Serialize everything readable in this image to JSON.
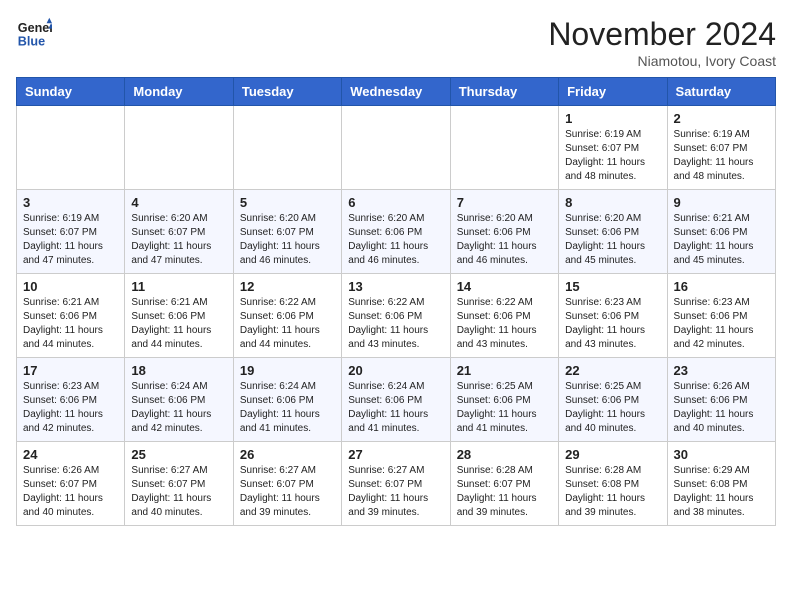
{
  "header": {
    "logo_line1": "General",
    "logo_line2": "Blue",
    "month": "November 2024",
    "location": "Niamotou, Ivory Coast"
  },
  "weekdays": [
    "Sunday",
    "Monday",
    "Tuesday",
    "Wednesday",
    "Thursday",
    "Friday",
    "Saturday"
  ],
  "weeks": [
    [
      {
        "day": "",
        "info": ""
      },
      {
        "day": "",
        "info": ""
      },
      {
        "day": "",
        "info": ""
      },
      {
        "day": "",
        "info": ""
      },
      {
        "day": "",
        "info": ""
      },
      {
        "day": "1",
        "info": "Sunrise: 6:19 AM\nSunset: 6:07 PM\nDaylight: 11 hours\nand 48 minutes."
      },
      {
        "day": "2",
        "info": "Sunrise: 6:19 AM\nSunset: 6:07 PM\nDaylight: 11 hours\nand 48 minutes."
      }
    ],
    [
      {
        "day": "3",
        "info": "Sunrise: 6:19 AM\nSunset: 6:07 PM\nDaylight: 11 hours\nand 47 minutes."
      },
      {
        "day": "4",
        "info": "Sunrise: 6:20 AM\nSunset: 6:07 PM\nDaylight: 11 hours\nand 47 minutes."
      },
      {
        "day": "5",
        "info": "Sunrise: 6:20 AM\nSunset: 6:07 PM\nDaylight: 11 hours\nand 46 minutes."
      },
      {
        "day": "6",
        "info": "Sunrise: 6:20 AM\nSunset: 6:06 PM\nDaylight: 11 hours\nand 46 minutes."
      },
      {
        "day": "7",
        "info": "Sunrise: 6:20 AM\nSunset: 6:06 PM\nDaylight: 11 hours\nand 46 minutes."
      },
      {
        "day": "8",
        "info": "Sunrise: 6:20 AM\nSunset: 6:06 PM\nDaylight: 11 hours\nand 45 minutes."
      },
      {
        "day": "9",
        "info": "Sunrise: 6:21 AM\nSunset: 6:06 PM\nDaylight: 11 hours\nand 45 minutes."
      }
    ],
    [
      {
        "day": "10",
        "info": "Sunrise: 6:21 AM\nSunset: 6:06 PM\nDaylight: 11 hours\nand 44 minutes."
      },
      {
        "day": "11",
        "info": "Sunrise: 6:21 AM\nSunset: 6:06 PM\nDaylight: 11 hours\nand 44 minutes."
      },
      {
        "day": "12",
        "info": "Sunrise: 6:22 AM\nSunset: 6:06 PM\nDaylight: 11 hours\nand 44 minutes."
      },
      {
        "day": "13",
        "info": "Sunrise: 6:22 AM\nSunset: 6:06 PM\nDaylight: 11 hours\nand 43 minutes."
      },
      {
        "day": "14",
        "info": "Sunrise: 6:22 AM\nSunset: 6:06 PM\nDaylight: 11 hours\nand 43 minutes."
      },
      {
        "day": "15",
        "info": "Sunrise: 6:23 AM\nSunset: 6:06 PM\nDaylight: 11 hours\nand 43 minutes."
      },
      {
        "day": "16",
        "info": "Sunrise: 6:23 AM\nSunset: 6:06 PM\nDaylight: 11 hours\nand 42 minutes."
      }
    ],
    [
      {
        "day": "17",
        "info": "Sunrise: 6:23 AM\nSunset: 6:06 PM\nDaylight: 11 hours\nand 42 minutes."
      },
      {
        "day": "18",
        "info": "Sunrise: 6:24 AM\nSunset: 6:06 PM\nDaylight: 11 hours\nand 42 minutes."
      },
      {
        "day": "19",
        "info": "Sunrise: 6:24 AM\nSunset: 6:06 PM\nDaylight: 11 hours\nand 41 minutes."
      },
      {
        "day": "20",
        "info": "Sunrise: 6:24 AM\nSunset: 6:06 PM\nDaylight: 11 hours\nand 41 minutes."
      },
      {
        "day": "21",
        "info": "Sunrise: 6:25 AM\nSunset: 6:06 PM\nDaylight: 11 hours\nand 41 minutes."
      },
      {
        "day": "22",
        "info": "Sunrise: 6:25 AM\nSunset: 6:06 PM\nDaylight: 11 hours\nand 40 minutes."
      },
      {
        "day": "23",
        "info": "Sunrise: 6:26 AM\nSunset: 6:06 PM\nDaylight: 11 hours\nand 40 minutes."
      }
    ],
    [
      {
        "day": "24",
        "info": "Sunrise: 6:26 AM\nSunset: 6:07 PM\nDaylight: 11 hours\nand 40 minutes."
      },
      {
        "day": "25",
        "info": "Sunrise: 6:27 AM\nSunset: 6:07 PM\nDaylight: 11 hours\nand 40 minutes."
      },
      {
        "day": "26",
        "info": "Sunrise: 6:27 AM\nSunset: 6:07 PM\nDaylight: 11 hours\nand 39 minutes."
      },
      {
        "day": "27",
        "info": "Sunrise: 6:27 AM\nSunset: 6:07 PM\nDaylight: 11 hours\nand 39 minutes."
      },
      {
        "day": "28",
        "info": "Sunrise: 6:28 AM\nSunset: 6:07 PM\nDaylight: 11 hours\nand 39 minutes."
      },
      {
        "day": "29",
        "info": "Sunrise: 6:28 AM\nSunset: 6:08 PM\nDaylight: 11 hours\nand 39 minutes."
      },
      {
        "day": "30",
        "info": "Sunrise: 6:29 AM\nSunset: 6:08 PM\nDaylight: 11 hours\nand 38 minutes."
      }
    ]
  ]
}
